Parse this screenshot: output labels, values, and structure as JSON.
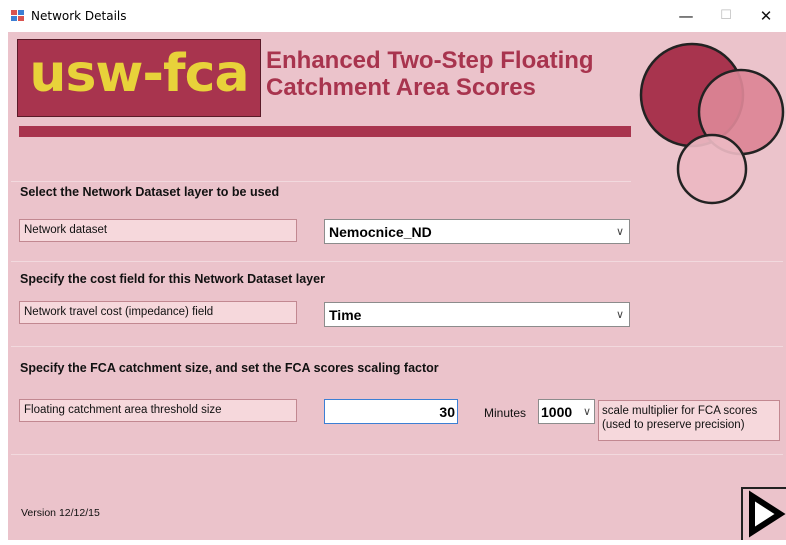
{
  "window": {
    "title": "Network Details",
    "controls": {
      "minimize": "—",
      "maximize": "☐",
      "close": "✕"
    }
  },
  "header": {
    "logo_text": "usw-fca",
    "title_line1": "Enhanced Two-Step Floating",
    "title_line2": "Catchment Area Scores"
  },
  "sections": {
    "dataset": {
      "heading": "Select the Network Dataset layer to be used",
      "label": "Network dataset",
      "selected": "Nemocnice_ND"
    },
    "cost": {
      "heading": "Specify the cost field for this Network Dataset layer",
      "label": "Network travel cost (impedance) field",
      "selected": "Time"
    },
    "catchment": {
      "heading": "Specify the FCA catchment size, and set the FCA scores scaling factor",
      "label": "Floating catchment area threshold size",
      "threshold_value": "30",
      "unit": "Minutes",
      "scale_value": "1000",
      "scale_note_line1": "scale multiplier for FCA scores",
      "scale_note_line2": "(used to preserve precision)"
    }
  },
  "footer": {
    "version": "Version 12/12/15",
    "next_icon": "play-triangle-icon"
  },
  "colors": {
    "background": "#ebc3cb",
    "accent": "#a8344e",
    "logo_text": "#e8d23a",
    "label_fill": "#f6d8dc"
  }
}
